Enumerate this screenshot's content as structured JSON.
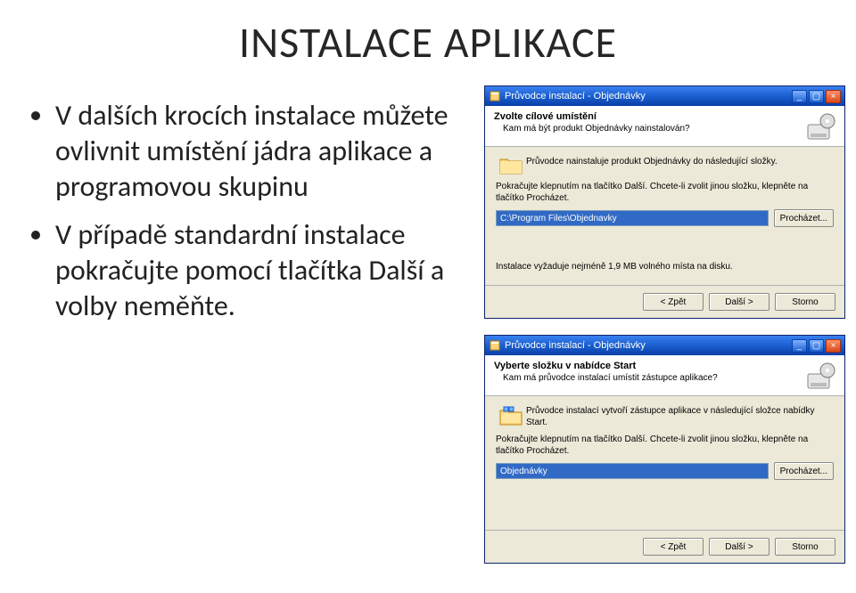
{
  "slide": {
    "title": "INSTALACE APLIKACE",
    "bullets": [
      "V dalších krocích instalace můžete ovlivnit umístění jádra aplikace a programovou skupinu",
      "V případě standardní instalace pokračujte pomocí tlačítka Další a volby neměňte."
    ]
  },
  "wiz1": {
    "title": "Průvodce instalací - Objednávky",
    "headerTitle": "Zvolte cílové umístění",
    "headerSub": "Kam má být produkt Objednávky nainstalován?",
    "line1": "Průvodce nainstaluje produkt Objednávky do následující složky.",
    "line2": "Pokračujte klepnutím na tlačítko Další. Chcete-li zvolit jinou složku, klepněte na tlačítko Procházet.",
    "path": "C:\\Program Files\\Objednavky",
    "browse": "Procházet...",
    "diskNote": "Instalace vyžaduje nejméně 1,9 MB volného místa na disku.",
    "back": "< Zpět",
    "next": "Další >",
    "cancel": "Storno"
  },
  "wiz2": {
    "title": "Průvodce instalací - Objednávky",
    "headerTitle": "Vyberte složku v nabídce Start",
    "headerSub": "Kam má průvodce instalací umístit zástupce aplikace?",
    "line1": "Průvodce instalací vytvoří zástupce aplikace v následující složce nabídky Start.",
    "line2": "Pokračujte klepnutím na tlačítko Další. Chcete-li zvolit jinou složku, klepněte na tlačítko Procházet.",
    "path": "Objednávky",
    "browse": "Procházet...",
    "back": "< Zpět",
    "next": "Další >",
    "cancel": "Storno"
  }
}
